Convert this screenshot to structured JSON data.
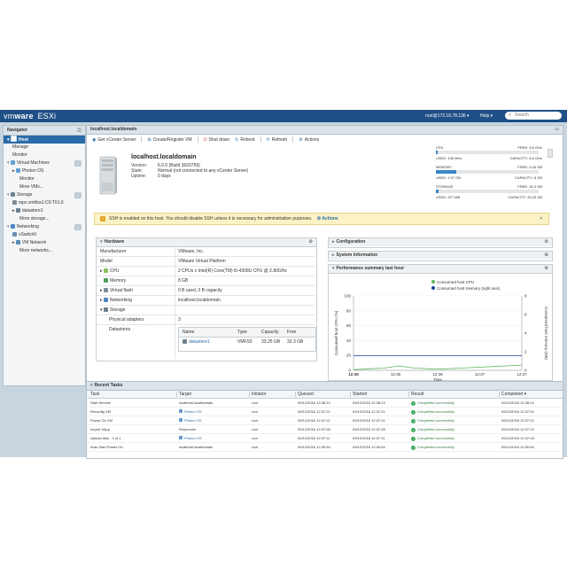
{
  "topbar": {
    "brand_vm": "vm",
    "brand_ware": "ware",
    "brand_product": "ESXi",
    "user": "root@172.16.78.136 ▾",
    "help": "Help ▾",
    "search_placeholder": "Search"
  },
  "navigator": {
    "title": "Navigator",
    "items": [
      {
        "label": "Host",
        "icon": "host-icon",
        "indent": 1,
        "selected": true
      },
      {
        "label": "Manage",
        "indent": 2
      },
      {
        "label": "Monitor",
        "indent": 2
      },
      {
        "label": "Virtual Machines",
        "icon": "vm-icon",
        "indent": 1,
        "count": "1"
      },
      {
        "label": "Photon OS",
        "icon": "vm-icon",
        "indent": 2,
        "arrow": "▸"
      },
      {
        "label": "Monitor",
        "indent": 3
      },
      {
        "label": "More VMs...",
        "indent": 3
      },
      {
        "label": "Storage",
        "icon": "storage-icon",
        "indent": 1,
        "count": "1"
      },
      {
        "label": "mpx.vmhba1:C0:T0:L0",
        "icon": "disk-icon",
        "indent": 2
      },
      {
        "label": "datastore1",
        "icon": "datastore-icon",
        "indent": 2,
        "arrow": "▸"
      },
      {
        "label": "More storage...",
        "indent": 3
      },
      {
        "label": "Networking",
        "icon": "network-icon",
        "indent": 1,
        "count": "1"
      },
      {
        "label": "vSwitch0",
        "icon": "switch-icon",
        "indent": 2
      },
      {
        "label": "VM Network",
        "icon": "portgroup-icon",
        "indent": 2,
        "arrow": "▸"
      },
      {
        "label": "More networks...",
        "indent": 3
      }
    ]
  },
  "content": {
    "title": "localhost.localdomain",
    "toolbar": {
      "get_vcenter": "Get vCenter Server",
      "create_vm": "Create/Register VM",
      "shutdown": "Shut down",
      "reboot": "Reboot",
      "refresh": "Refresh",
      "actions": "Actions"
    },
    "host": {
      "name": "localhost.localdomain",
      "version_label": "Version:",
      "version_value": "6.0.0 (Build 3620759)",
      "state_label": "State:",
      "state_value": "Normal (not connected to any vCenter Server)",
      "uptime_label": "Uptime:",
      "uptime_value": "0 days"
    },
    "resources": {
      "cpu": {
        "label": "CPU",
        "free": "FREE: 5.6 GHz",
        "percent_text": "2%",
        "fill": 0.02,
        "used": "USED: 136 MHz",
        "capacity": "CAPACITY: 5.6 GHz"
      },
      "memory": {
        "label": "MEMORY",
        "free": "FREE: 6.43 GB",
        "percent_text": "20%",
        "fill": 0.2,
        "used": "USED: 1.57 GB",
        "capacity": "CAPACITY: 8 GB"
      },
      "storage": {
        "label": "STORAGE",
        "free": "FREE: 32.3 GB",
        "percent_text": "3%",
        "fill": 0.03,
        "used": "USED: 977 MB",
        "capacity": "CAPACITY: 33.25 GB"
      }
    },
    "alert": {
      "text": "SSH is enabled on this host. You should disable SSH unless it is necessary for administrative purposes.",
      "action": "Actions"
    },
    "hardware": {
      "title": "Hardware",
      "manufacturer_k": "Manufacturer",
      "manufacturer_v": "VMware, Inc.",
      "model_k": "Model",
      "model_v": "VMware Virtual Platform",
      "cpu_k": "CPU",
      "cpu_v": "2 CPUs x Intel(R) Core(TM) i5-4308U CPU @ 2.80GHz",
      "memory_k": "Memory",
      "memory_v": "8 GB",
      "vflash_k": "Virtual flash",
      "vflash_v": "0 B used, 0 B capacity",
      "networking_k": "Networking",
      "networking_v": "localhost.localdomain",
      "storage_k": "Storage",
      "adapters_k": "Physical adapters",
      "adapters_v": "3",
      "datastores_k": "Datastores",
      "ds_headers": [
        "Name",
        "Type",
        "Capacity",
        "Free"
      ],
      "ds_row": {
        "name": "datastore1",
        "type": "VMFS5",
        "capacity": "33.25 GB",
        "free": "32.3 GB"
      }
    },
    "configuration_title": "Configuration",
    "sysinfo_title": "System Information",
    "perf_title": "Performance summary last hour"
  },
  "chart_data": {
    "type": "line",
    "title": "",
    "legend": [
      "Consumed host CPU",
      "Consumed host memory (right axis)"
    ],
    "legend_colors": [
      "#5cb85c",
      "#1f3f99"
    ],
    "xlabel": "Time",
    "ylabel": "Consumed host CPU (%)",
    "ylabel_right": "Consumed host memory (GB)",
    "x_ticks": [
      "12:35",
      "12:36",
      "12:36",
      "12:37",
      "12:37"
    ],
    "y_ticks": [
      "0",
      "20",
      "40",
      "60",
      "80",
      "100"
    ],
    "y2_ticks": [
      "0",
      "2",
      "4",
      "6",
      "8"
    ],
    "ylim": [
      0,
      100
    ],
    "y2lim": [
      0,
      8
    ],
    "series": [
      {
        "name": "Consumed host CPU",
        "color": "#5cb85c",
        "axis": "left",
        "values": [
          1,
          2,
          3,
          6,
          3,
          2,
          2,
          3,
          4,
          5,
          6,
          7
        ]
      },
      {
        "name": "Consumed host memory (right axis)",
        "color": "#1f3f99",
        "axis": "right",
        "values": [
          1.57,
          1.57,
          1.57,
          1.57,
          1.57,
          1.57,
          1.57,
          1.57,
          1.57,
          1.57,
          1.57,
          1.57
        ]
      }
    ]
  },
  "tasks": {
    "title": "Recent Tasks",
    "headers": [
      "Task",
      "Target",
      "Initiator",
      "Queued",
      "Started",
      "Result",
      "Completed ▾"
    ],
    "rows": [
      {
        "task": "Start Service",
        "target": "localhost.localdomain",
        "target_link": false,
        "initiator": "root",
        "queued": "09/12/2016 12:38:13",
        "started": "09/12/2016 12:38:13",
        "result": "Completed successfully",
        "completed": "09/12/2016 12:38:13"
      },
      {
        "task": "Reconfig VM",
        "target": "Photon OS",
        "target_link": true,
        "initiator": "root",
        "queued": "09/12/2016 12:37:21",
        "started": "09/12/2016 12:37:21",
        "result": "Completed successfully",
        "completed": "09/12/2016 12:37:21"
      },
      {
        "task": "Power On VM",
        "target": "Photon OS",
        "target_link": true,
        "initiator": "root",
        "queued": "09/12/2016 12:37:21",
        "started": "09/12/2016 12:37:21",
        "result": "Completed successfully",
        "completed": "09/12/2016 12:37:21"
      },
      {
        "task": "Import VApp",
        "target": "Resources",
        "target_link": false,
        "initiator": "root",
        "queued": "09/12/2016 12:37:08",
        "started": "09/12/2016 12:37:08",
        "result": "Completed successfully",
        "completed": "09/12/2016 12:37:19"
      },
      {
        "task": "Upload disk - 1 of 1",
        "target": "Photon OS",
        "target_link": true,
        "initiator": "root",
        "queued": "09/12/2016 12:37:11",
        "started": "09/12/2016 12:37:11",
        "result": "Completed successfully",
        "completed": "09/12/2016 12:37:18"
      },
      {
        "task": "Auto Start Power On",
        "target": "localhost.localdomain",
        "target_link": false,
        "initiator": "root",
        "queued": "09/12/2016 12:30:54",
        "started": "09/12/2016 12:30:54",
        "result": "Completed successfully",
        "completed": "09/12/2016 12:30:54"
      }
    ]
  }
}
